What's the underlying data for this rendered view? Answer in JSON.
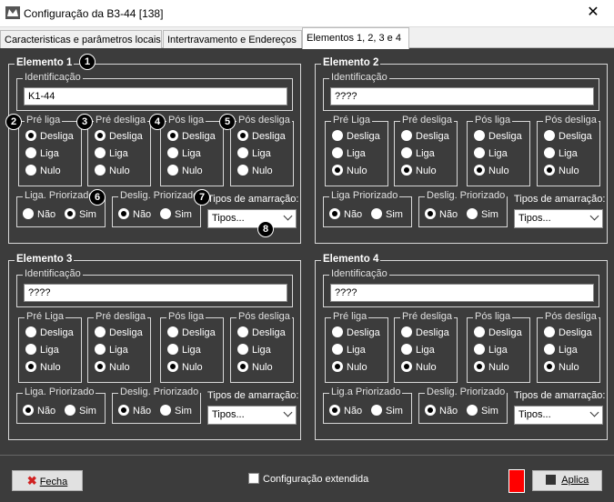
{
  "window": {
    "title": "Configuração da B3-44  [138]",
    "close_glyph": "✕"
  },
  "tabs": [
    {
      "label": "Caracteristicas  e parâmetros locais"
    },
    {
      "label": "Intertravamento e Endereços"
    },
    {
      "label": "Elementos 1, 2, 3 e 4"
    }
  ],
  "callouts": [
    "1",
    "2",
    "3",
    "4",
    "5",
    "6",
    "7",
    "8"
  ],
  "common": {
    "id_legend": "Identificação",
    "amarracao_label": "Tipos de amarração:",
    "amarracao_value": "Tipos...",
    "nao": "Não",
    "sim": "Sim",
    "opt_desliga": "Desliga",
    "opt_liga": "Liga",
    "opt_nulo": "Nulo",
    "deslig_priorizado": "Deslig. Priorizado"
  },
  "elements": [
    {
      "title": "Elemento 1",
      "id_value": "K1-44",
      "groups": [
        {
          "legend": "Pré liga",
          "selected": "Desliga"
        },
        {
          "legend": "Pré desliga",
          "selected": "Desliga"
        },
        {
          "legend": "Pós liga",
          "selected": "Desliga"
        },
        {
          "legend": "Pós desliga",
          "selected": "Desliga"
        }
      ],
      "liga_priorizado": "Liga. Priorizado",
      "liga_selected": "Sim",
      "deslig_selected": "Não"
    },
    {
      "title": "Elemento 2",
      "id_value": "????",
      "groups": [
        {
          "legend": "Pré Liga",
          "selected": "Nulo"
        },
        {
          "legend": "Pré desliga",
          "selected": "Nulo"
        },
        {
          "legend": "Pós liga",
          "selected": "Nulo"
        },
        {
          "legend": "Pós desliga",
          "selected": "Nulo"
        }
      ],
      "liga_priorizado": "Liga Priorizado",
      "liga_selected": "Não",
      "deslig_selected": "Não"
    },
    {
      "title": "Elemento 3",
      "id_value": "????",
      "groups": [
        {
          "legend": "Pré Liga",
          "selected": "Nulo"
        },
        {
          "legend": "Pré desliga",
          "selected": "Nulo"
        },
        {
          "legend": "Pós liga",
          "selected": "Nulo"
        },
        {
          "legend": "Pós desliga",
          "selected": "Nulo"
        }
      ],
      "liga_priorizado": "Liga. Priorizado",
      "liga_selected": "Não",
      "deslig_selected": "Não"
    },
    {
      "title": "Elemento 4",
      "id_value": "????",
      "groups": [
        {
          "legend": "Pré liga",
          "selected": "Nulo"
        },
        {
          "legend": "Pré desliga",
          "selected": "Nulo"
        },
        {
          "legend": "Pós liga",
          "selected": "Nulo"
        },
        {
          "legend": "Pós desliga",
          "selected": "Nulo"
        }
      ],
      "liga_priorizado": "Lig.a Priorizado",
      "liga_selected": "Não",
      "deslig_selected": "Não"
    }
  ],
  "bottom": {
    "fecha_label": "Fecha",
    "extendida_label": "Configuração extendida",
    "aplica_label": "Aplica",
    "status_color": "#ff0000"
  },
  "colors": {
    "panel_bg": "#3c3c3c",
    "accent_close": "#cc2222"
  }
}
